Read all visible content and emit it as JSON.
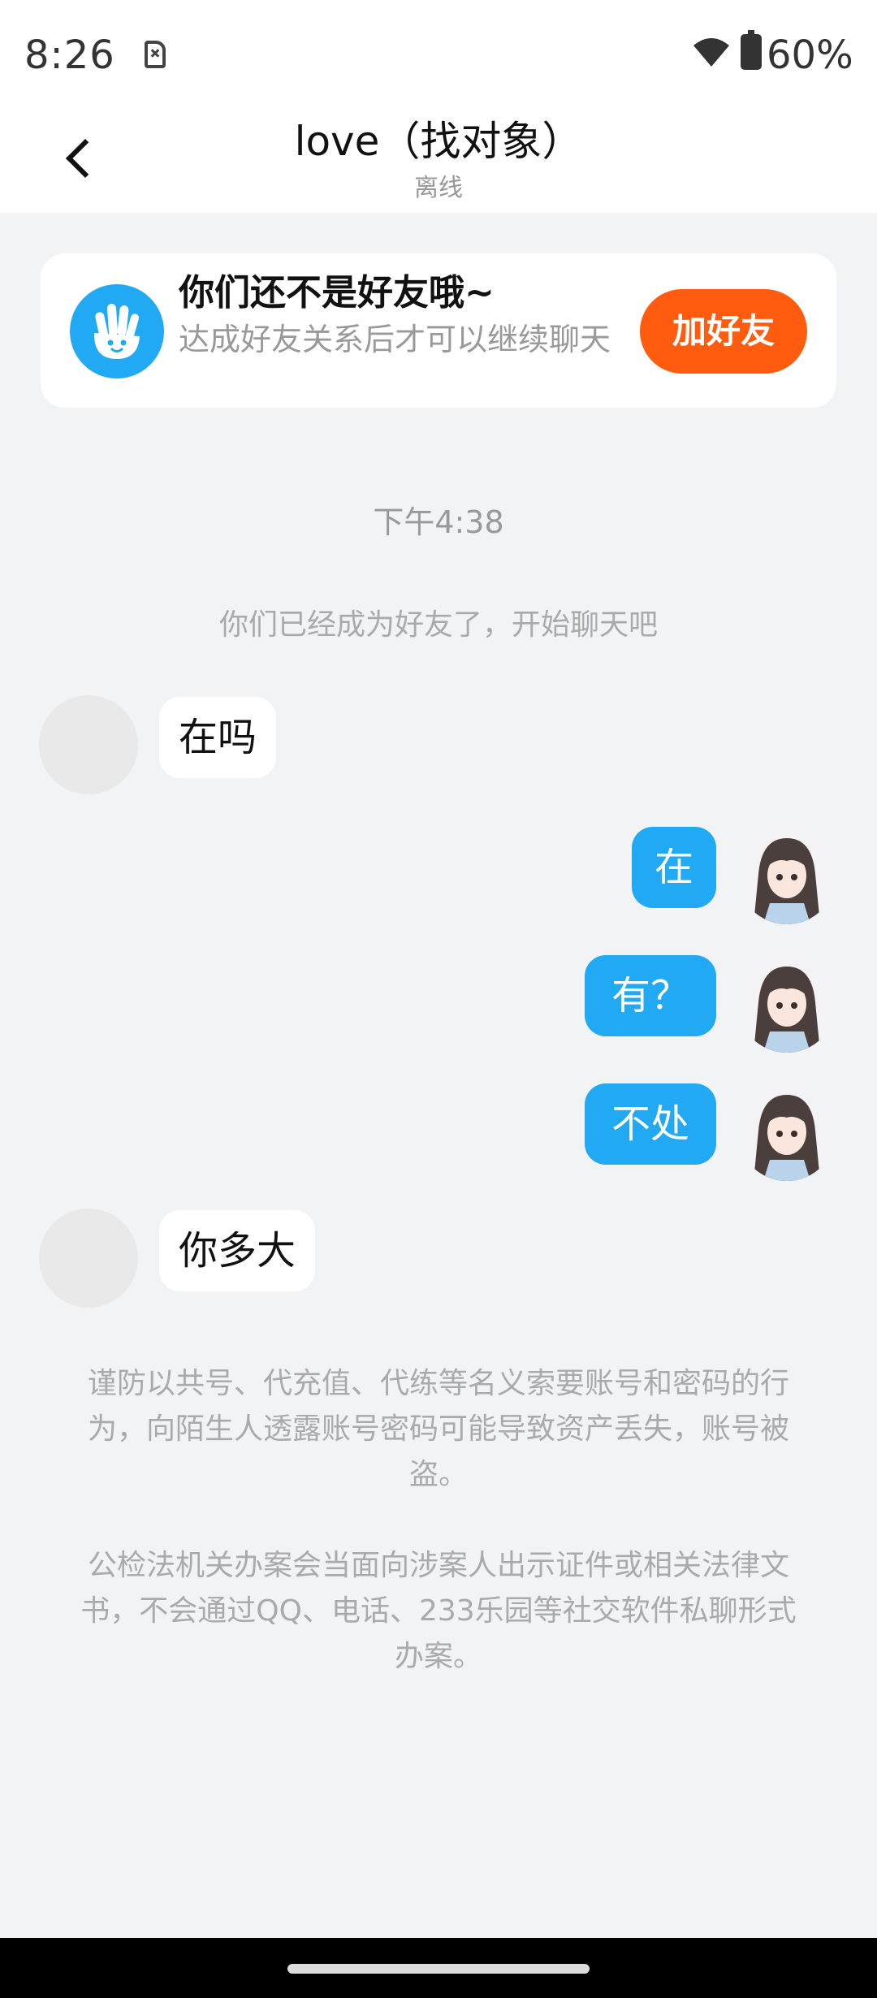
{
  "status_bar": {
    "time": "8:26",
    "battery": "60%"
  },
  "header": {
    "title": "love（找对象）",
    "subtitle": "离线"
  },
  "friend_banner": {
    "title": "你们还不是好友哦~",
    "description": "达成好友关系后才可以继续聊天",
    "button_label": "加好友",
    "icon": "wave-hand-icon",
    "icon_color": "#21aaf3",
    "button_color": "#ff5c0f"
  },
  "chat": {
    "timestamp": "下午4:38",
    "system_note": "你们已经成为好友了，开始聊天吧",
    "messages": [
      {
        "from": "other",
        "text": "在吗"
      },
      {
        "from": "me",
        "text": "在"
      },
      {
        "from": "me",
        "text": "有？"
      },
      {
        "from": "me",
        "text": "不处"
      },
      {
        "from": "other",
        "text": "你多大"
      }
    ],
    "bubble_color_me": "#21aaf3",
    "bubble_color_other": "#ffffff"
  },
  "tips": {
    "security": "谨防以共号、代充值、代练等名义索要账号和密码的行为，向陌生人透露账号密码可能导致资产丢失，账号被盗。",
    "police": "公检法机关办案会当面向涉案人出示证件或相关法律文书，不会通过QQ、电话、233乐园等社交软件私聊形式办案。"
  }
}
